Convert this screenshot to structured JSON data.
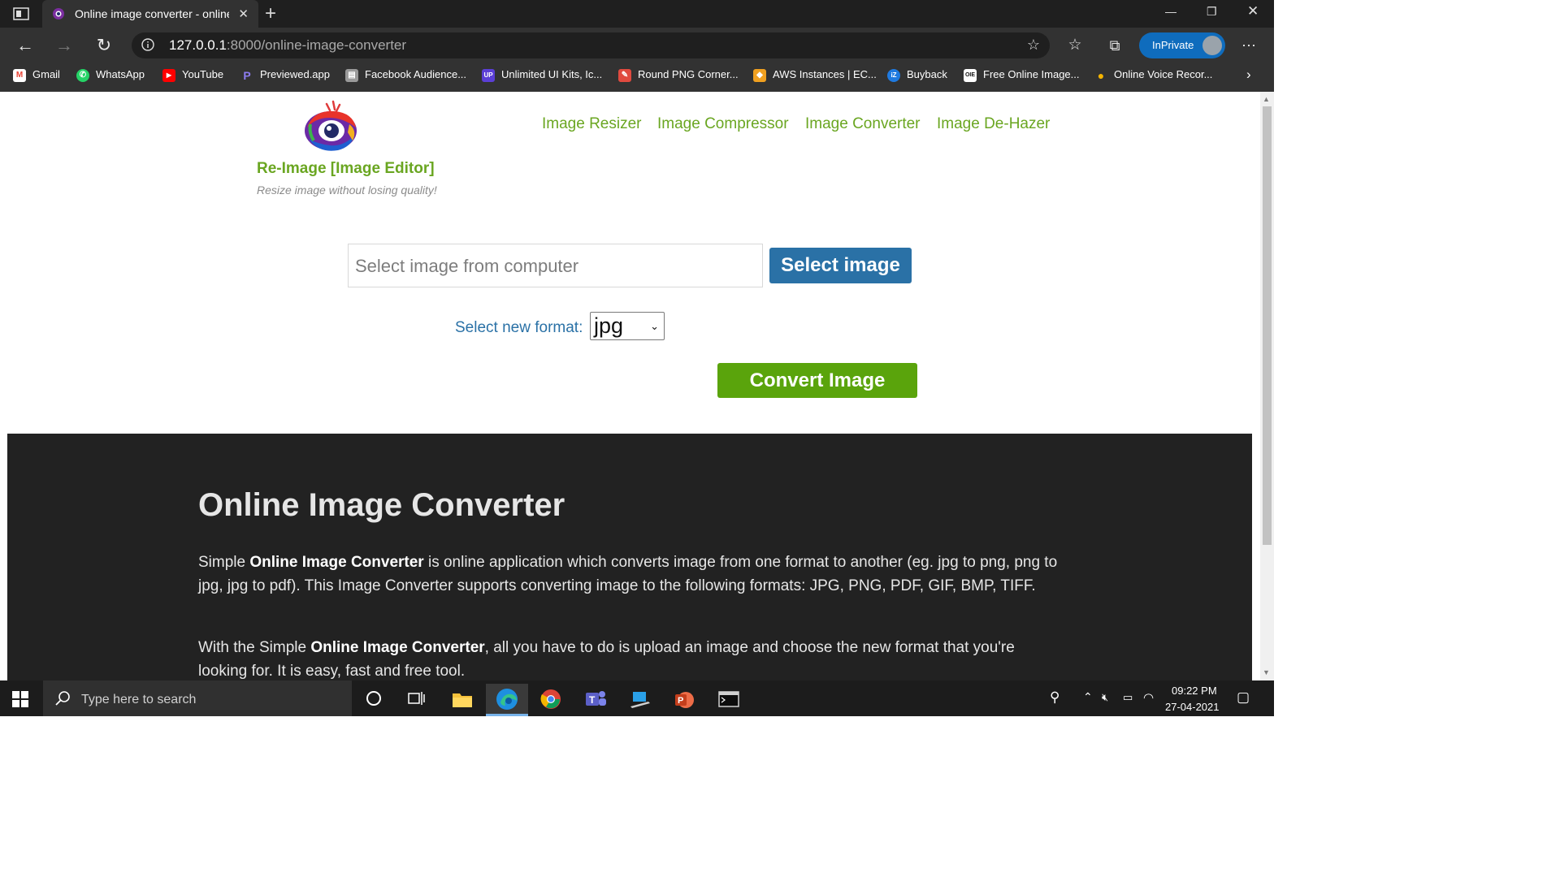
{
  "browser": {
    "tab_title": "Online image converter - online",
    "url_host": "127.0.0.1",
    "url_path": ":8000/online-image-converter",
    "inprivate_label": "InPrivate",
    "bookmarks": [
      {
        "label": "Gmail",
        "icon": "gmail-icon",
        "color": "#ea4335",
        "glyph": "M"
      },
      {
        "label": "WhatsApp",
        "icon": "whatsapp-icon",
        "color": "#25d366",
        "glyph": "✆"
      },
      {
        "label": "YouTube",
        "icon": "youtube-icon",
        "color": "#ff0000",
        "glyph": "▶"
      },
      {
        "label": "Previewed.app",
        "icon": "previewed-icon",
        "color": "#6b5bd6",
        "glyph": "P"
      },
      {
        "label": "Facebook Audience...",
        "icon": "facebook-audience-icon",
        "color": "#8a8a8a",
        "glyph": "▤"
      },
      {
        "label": "Unlimited UI Kits, Ic...",
        "icon": "ui-kits-icon",
        "color": "#5b3fd6",
        "glyph": "UP"
      },
      {
        "label": "Round PNG Corner...",
        "icon": "round-png-icon",
        "color": "#e04a3f",
        "glyph": "✎"
      },
      {
        "label": "AWS Instances | EC...",
        "icon": "aws-icon",
        "color": "#f0a020",
        "glyph": "◆"
      },
      {
        "label": "Buyback",
        "icon": "buyback-icon",
        "color": "#1f7ae0",
        "glyph": "iZ"
      },
      {
        "label": "Free Online Image...",
        "icon": "free-online-image-icon",
        "color": "#ffffff",
        "glyph": "OIE"
      },
      {
        "label": "Online Voice Recor...",
        "icon": "voice-recorder-icon",
        "color": "#f5b400",
        "glyph": "●"
      }
    ]
  },
  "site": {
    "brand_name": "Re-Image [Image Editor]",
    "tagline": "Resize image without losing quality!",
    "nav": [
      "Image Resizer",
      "Image Compressor",
      "Image Converter",
      "Image De-Hazer"
    ]
  },
  "converter": {
    "file_placeholder": "Select image from computer",
    "select_button": "Select image",
    "format_label": "Select new format:",
    "format_value": "jpg",
    "convert_button": "Convert Image"
  },
  "info": {
    "heading": "Online Image Converter",
    "p1_pre": "Simple ",
    "p1_bold": "Online Image Converter",
    "p1_post": " is online application which converts image from one format to another (eg. jpg to png, png to jpg, jpg to pdf). This Image Converter supports converting image to the following formats: JPG, PNG, PDF, GIF, BMP, TIFF.",
    "p2_pre": "With the Simple ",
    "p2_bold": "Online Image Converter",
    "p2_post": ", all you have to do is upload an image and choose the new format that you're looking for. It is easy, fast and free tool."
  },
  "taskbar": {
    "search_placeholder": "Type here to search",
    "time": "09:22 PM",
    "date": "27-04-2021",
    "apps": [
      "cortana-icon",
      "task-view-icon",
      "file-explorer-icon",
      "edge-icon",
      "chrome-icon",
      "teams-icon",
      "network-app-icon",
      "powerpoint-icon",
      "terminal-icon"
    ]
  }
}
